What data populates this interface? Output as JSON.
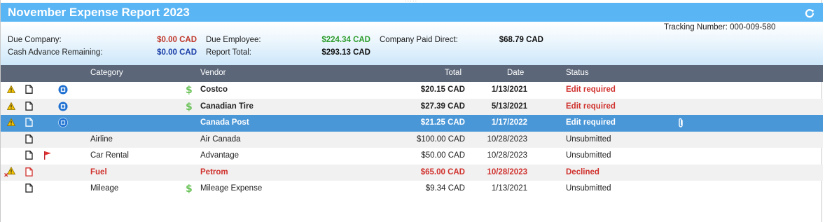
{
  "report": {
    "title": "November Expense Report 2023",
    "tracking": "Tracking Number: 000-009-580"
  },
  "summary": {
    "due_company_label": "Due Company:",
    "due_company_value": "$0.00 CAD",
    "cash_advance_label": "Cash Advance Remaining:",
    "cash_advance_value": "$0.00 CAD",
    "due_employee_label": "Due Employee:",
    "due_employee_value": "$224.34 CAD",
    "report_total_label": "Report Total:",
    "report_total_value": "$293.13 CAD",
    "company_paid_label": "Company Paid Direct:",
    "company_paid_value": "$68.79 CAD"
  },
  "columns": {
    "category": "Category",
    "vendor": "Vendor",
    "total": "Total",
    "date": "Date",
    "status": "Status"
  },
  "rows": [
    {
      "category": "",
      "vendor": "Costco",
      "total": "$20.15 CAD",
      "date": "1/13/2021",
      "status": "Edit required"
    },
    {
      "category": "",
      "vendor": "Canadian Tire",
      "total": "$27.39 CAD",
      "date": "5/13/2021",
      "status": "Edit required"
    },
    {
      "category": "",
      "vendor": "Canada Post",
      "total": "$21.25 CAD",
      "date": "1/17/2022",
      "status": "Edit required"
    },
    {
      "category": "Airline",
      "vendor": "Air Canada",
      "total": "$100.00 CAD",
      "date": "10/28/2023",
      "status": "Unsubmitted"
    },
    {
      "category": "Car Rental",
      "vendor": "Advantage",
      "total": "$50.00 CAD",
      "date": "10/28/2023",
      "status": "Unsubmitted"
    },
    {
      "category": "Fuel",
      "vendor": "Petrom",
      "total": "$65.00 CAD",
      "date": "10/28/2023",
      "status": "Declined"
    },
    {
      "category": "Mileage",
      "vendor": "Mileage Expense",
      "total": "$9.34 CAD",
      "date": "1/13/2021",
      "status": "Unsubmitted"
    }
  ],
  "icons": {
    "warning": "warning-icon",
    "document": "document-icon",
    "company_card": "company-card-icon",
    "money": "money-icon",
    "flag": "flag-icon",
    "attachment": "paperclip-icon",
    "refresh": "refresh-icon",
    "declined": "declined-x-icon"
  },
  "colors": {
    "title_bar": "#5ab5f5",
    "header_bar": "#5b6678",
    "selected_row": "#4a97d8",
    "due_company": "#c0392b",
    "due_employee": "#2e9e2e",
    "cash_advance": "#1a3ea8",
    "edit_required": "#d0312d"
  }
}
